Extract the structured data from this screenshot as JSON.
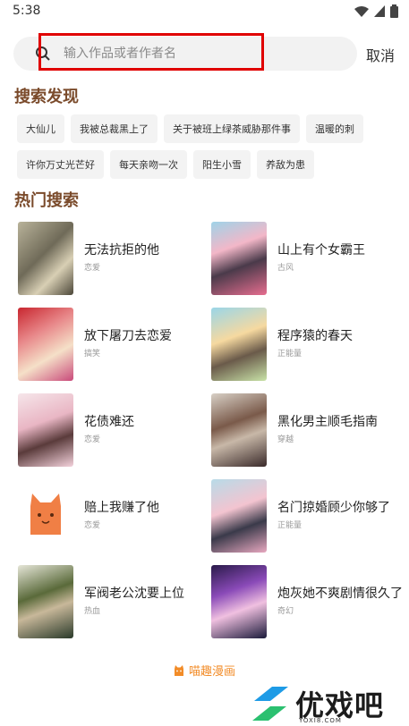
{
  "status": {
    "time": "5:38"
  },
  "search": {
    "placeholder": "输入作品或者作者名",
    "cancel": "取消"
  },
  "discover": {
    "title": "搜索发现",
    "tags_row1": [
      "大仙儿",
      "我被总裁黑上了",
      "关于被班上绿茶威胁那件事",
      "温暖的刺"
    ],
    "tags_row2": [
      "许你万丈光芒好",
      "每天亲吻一次",
      "阳生小雪",
      "养敌为患"
    ]
  },
  "hot": {
    "title": "热门搜索",
    "items": [
      {
        "name": "无法抗拒的他",
        "genre": "恋爱"
      },
      {
        "name": "山上有个女霸王",
        "genre": "古风"
      },
      {
        "name": "放下屠刀去恋爱",
        "genre": "搞笑"
      },
      {
        "name": "程序猿的春天",
        "genre": "正能量"
      },
      {
        "name": "花债难还",
        "genre": "恋爱"
      },
      {
        "name": "黑化男主顺毛指南",
        "genre": "穿越"
      },
      {
        "name": "赔上我赚了他",
        "genre": "恋爱"
      },
      {
        "name": "名门掠婚顾少你够了",
        "genre": "正能量"
      },
      {
        "name": "军阀老公沈要上位",
        "genre": "热血"
      },
      {
        "name": "炮灰她不爽剧情很久了",
        "genre": "奇幻"
      }
    ]
  },
  "footer": {
    "brand": "喵趣漫画"
  },
  "watermark": {
    "text": "优戏吧",
    "url": "YOXI8.COM"
  },
  "colors": {
    "accent": "#f28c28",
    "section_title": "#7a4a2a",
    "highlight": "#e00000"
  }
}
